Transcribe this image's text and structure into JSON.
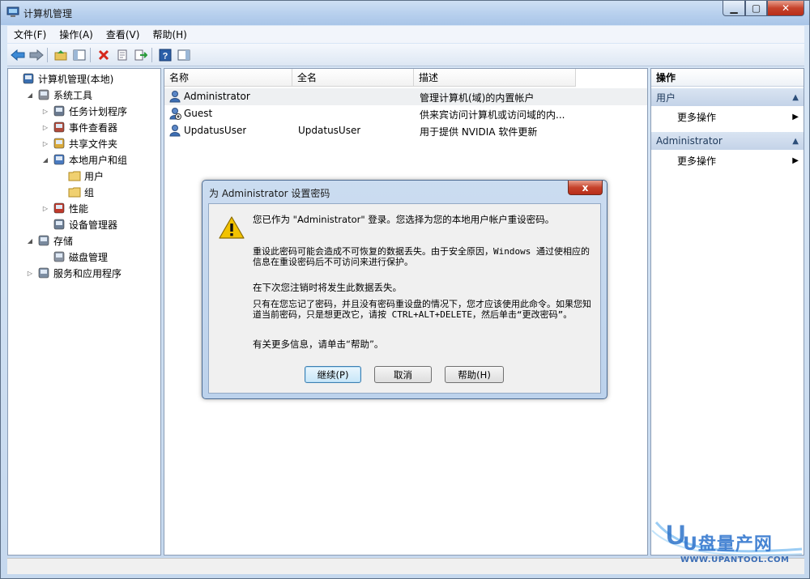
{
  "window": {
    "title": "计算机管理"
  },
  "menu": [
    "文件(F)",
    "操作(A)",
    "查看(V)",
    "帮助(H)"
  ],
  "toolbar": [
    "back-icon",
    "forward-icon",
    "up-folder-icon",
    "show-hide-tree-icon",
    "delete-icon",
    "properties-icon",
    "export-icon",
    "help-icon",
    "show-hide-action-pane-icon"
  ],
  "tree": [
    {
      "label": "计算机管理(本地)",
      "icon": "computer-management-icon",
      "level": 0,
      "expander": ""
    },
    {
      "label": "系统工具",
      "icon": "system-tools-icon",
      "level": 1,
      "expander": "◢"
    },
    {
      "label": "任务计划程序",
      "icon": "task-scheduler-icon",
      "level": 2,
      "expander": "▷"
    },
    {
      "label": "事件查看器",
      "icon": "event-viewer-icon",
      "level": 2,
      "expander": "▷"
    },
    {
      "label": "共享文件夹",
      "icon": "shared-folders-icon",
      "level": 2,
      "expander": "▷"
    },
    {
      "label": "本地用户和组",
      "icon": "local-users-icon",
      "level": 2,
      "expander": "◢"
    },
    {
      "label": "用户",
      "icon": "folder-icon",
      "level": 3,
      "expander": ""
    },
    {
      "label": "组",
      "icon": "folder-icon",
      "level": 3,
      "expander": ""
    },
    {
      "label": "性能",
      "icon": "performance-icon",
      "level": 2,
      "expander": "▷"
    },
    {
      "label": "设备管理器",
      "icon": "device-manager-icon",
      "level": 2,
      "expander": ""
    },
    {
      "label": "存储",
      "icon": "storage-icon",
      "level": 1,
      "expander": "◢"
    },
    {
      "label": "磁盘管理",
      "icon": "disk-management-icon",
      "level": 2,
      "expander": ""
    },
    {
      "label": "服务和应用程序",
      "icon": "services-apps-icon",
      "level": 1,
      "expander": "▷"
    }
  ],
  "list": {
    "columns": [
      "名称",
      "全名",
      "描述"
    ],
    "rows": [
      {
        "name": "Administrator",
        "fullname": "",
        "description": "管理计算机(域)的内置帐户"
      },
      {
        "name": "Guest",
        "fullname": "",
        "description": "供来宾访问计算机或访问域的内..."
      },
      {
        "name": "UpdatusUser",
        "fullname": "UpdatusUser",
        "description": "用于提供 NVIDIA 软件更新"
      }
    ]
  },
  "actions": {
    "header": "操作",
    "sections": [
      {
        "title": "用户",
        "item": "更多操作"
      },
      {
        "title": "Administrator",
        "item": "更多操作"
      }
    ]
  },
  "dialog": {
    "title": "为 Administrator 设置密码",
    "close": "x",
    "p1": "您已作为 \"Administrator\" 登录。您选择为您的本地用户帐户重设密码。",
    "p2": "重设此密码可能会造成不可恢复的数据丢失。由于安全原因，Windows 通过使相应的信息在重设密码后不可访问来进行保护。",
    "p3": "在下次您注销时将发生此数据丢失。",
    "p4": "只有在您忘记了密码，并且没有密码重设盘的情况下，您才应该使用此命令。如果您知道当前密码，只是想更改它，请按 CTRL+ALT+DELETE，然后单击“更改密码”。",
    "p5": "有关更多信息，请单击“帮助”。",
    "buttons": {
      "continue": "继续(P)",
      "cancel": "取消",
      "help": "帮助(H)"
    }
  },
  "watermark": {
    "brand": "U盘量产网",
    "url": "WWW.UPANTOOL.COM"
  }
}
